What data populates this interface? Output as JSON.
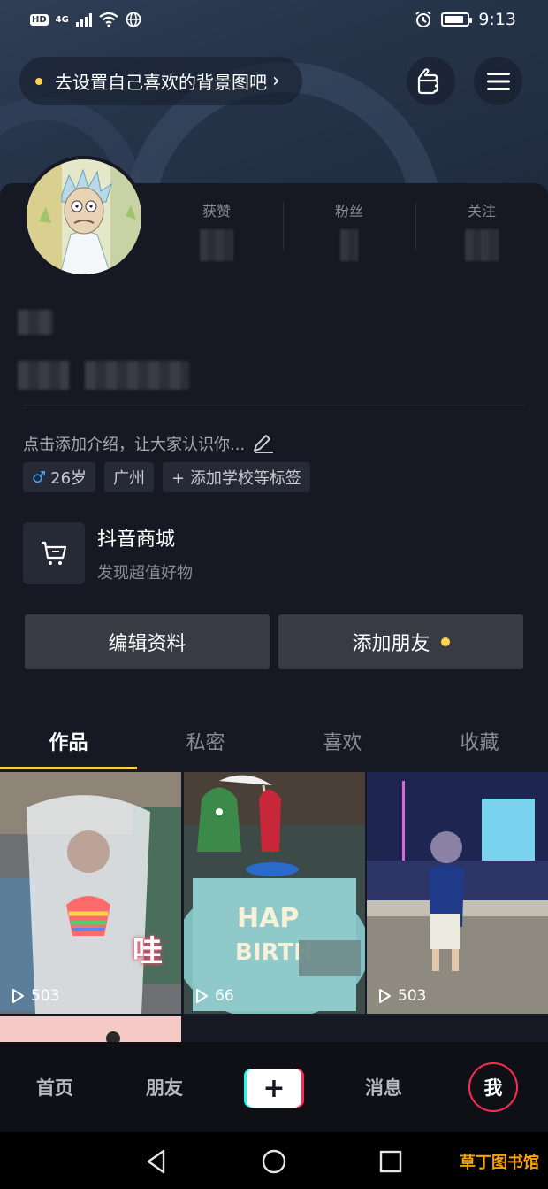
{
  "status_bar": {
    "hd_label": "HD",
    "network_label": "4G",
    "time": "9:13",
    "icons": [
      "signal-icon",
      "wifi-icon",
      "globe-icon",
      "alarm-icon",
      "battery-icon"
    ]
  },
  "top_bar": {
    "background_tip": "去设置自己喜欢的背景图吧",
    "tip_chevron": "›",
    "icons": [
      "hand-pointer-icon",
      "menu-icon"
    ]
  },
  "profile": {
    "stats": [
      {
        "label": "获赞"
      },
      {
        "label": "粉丝"
      },
      {
        "label": "关注"
      }
    ],
    "bio_placeholder": "点击添加介绍，让大家认识你...",
    "tags": {
      "gender_symbol": "♂",
      "age": "26岁",
      "city": "广州",
      "add_tag": "+ 添加学校等标签"
    }
  },
  "shop": {
    "title": "抖音商城",
    "subtitle": "发现超值好物"
  },
  "actions": {
    "edit_profile": "编辑资料",
    "add_friend": "添加朋友"
  },
  "tabs": [
    {
      "label": "作品",
      "active": true
    },
    {
      "label": "私密",
      "active": false
    },
    {
      "label": "喜欢",
      "active": false
    },
    {
      "label": "收藏",
      "active": false
    }
  ],
  "videos": [
    {
      "plays": "503",
      "caption_overlay": "哇"
    },
    {
      "plays": "66"
    },
    {
      "plays": "503"
    }
  ],
  "bottom_nav": {
    "home": "首页",
    "friends": "朋友",
    "create": "+",
    "messages": "消息",
    "me": "我"
  },
  "watermark": "草丁图书馆",
  "colors": {
    "accent_yellow": "#fcd34d",
    "tiktok_red": "#fe2c55",
    "tiktok_cyan": "#25f4ee",
    "background": "#161823"
  }
}
